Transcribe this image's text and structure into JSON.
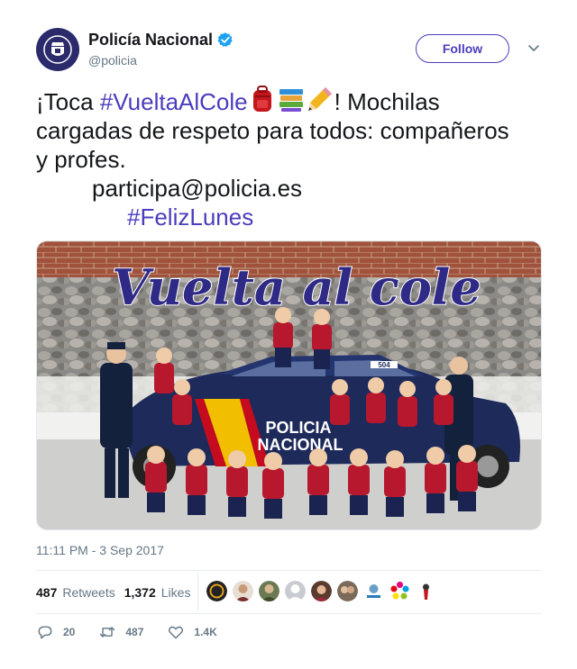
{
  "author": {
    "display_name": "Policía Nacional",
    "handle": "@policia",
    "verified": true,
    "avatar_icon": "police-badge-icon",
    "brand_color": "#2b2a6b"
  },
  "follow_label": "Follow",
  "accent_color": "#4a3dbd",
  "tweet": {
    "line1_prefix": "¡Toca ",
    "line1_hashtag": "#VueltaAlCole",
    "line1_emojis": [
      "backpack-icon",
      "books-icon",
      "pencil-icon"
    ],
    "line1_suffix": "! Mochilas",
    "line2": "cargadas de respeto para todos: compañeros",
    "line3": "y profes.",
    "line4": "participa@policia.es",
    "line5_hashtag": "#FelizLunes"
  },
  "photo": {
    "banner_text": "Vuelta al cole",
    "car_text_line1": "POLICIA",
    "car_text_line2": "NACIONAL",
    "car_number": "504"
  },
  "timestamp": "11:11 PM - 3 Sep 2017",
  "stats": {
    "retweets_count": "487",
    "retweets_label": "Retweets",
    "likes_count": "1,372",
    "likes_label": "Likes"
  },
  "liker_avatars": [
    "avatar",
    "avatar",
    "avatar",
    "avatar",
    "avatar",
    "avatar",
    "avatar",
    "avatar",
    "avatar"
  ],
  "actions": {
    "reply_count": "20",
    "retweet_count": "487",
    "like_count": "1.4K"
  }
}
